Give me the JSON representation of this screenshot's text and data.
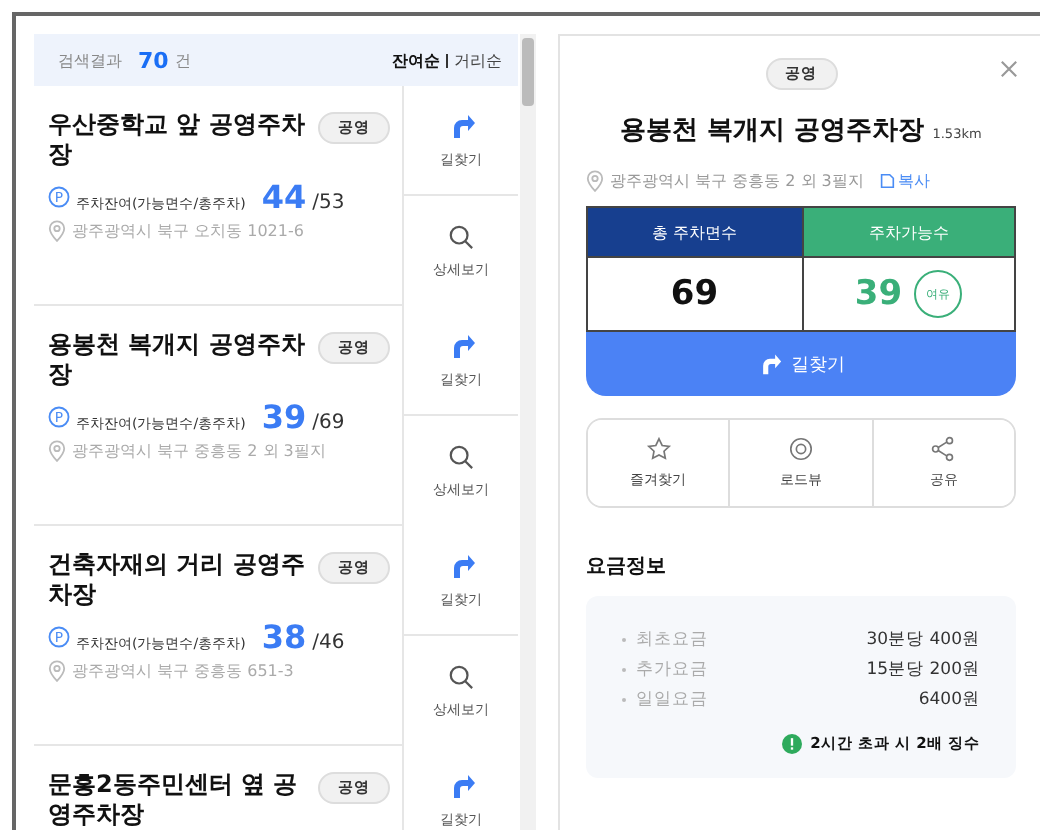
{
  "results_header": {
    "label": "검색결과",
    "count": "70",
    "unit": "건",
    "sort_options": [
      {
        "label": "잔여순",
        "selected": true
      },
      {
        "label": "거리순",
        "selected": false
      }
    ]
  },
  "parking_list": [
    {
      "name": "우산중학교 앞 공영주차장",
      "badge": "공영",
      "parking_icon": "P",
      "availability_label": "주차잔여(가능면수/총주차)",
      "available": "44",
      "total": "/53",
      "address": "광주광역시 북구 오치동 1021-6",
      "actions": [
        "길찾기",
        "상세보기"
      ]
    },
    {
      "name": "용봉천 복개지 공영주차장",
      "badge": "공영",
      "parking_icon": "P",
      "availability_label": "주차잔여(가능면수/총주차)",
      "available": "39",
      "total": "/69",
      "address": "광주광역시 북구 중흥동 2 외 3필지",
      "actions": [
        "길찾기",
        "상세보기"
      ]
    },
    {
      "name": "건축자재의 거리 공영주차장",
      "badge": "공영",
      "parking_icon": "P",
      "availability_label": "주차잔여(가능면수/총주차)",
      "available": "38",
      "total": "/46",
      "address": "광주광역시 북구 중흥동 651-3",
      "actions": [
        "길찾기",
        "상세보기"
      ]
    },
    {
      "name": "문흥2동주민센터 옆 공영주차장",
      "badge": "공영",
      "actions": [
        "길찾기"
      ]
    }
  ],
  "detail": {
    "badge": "공영",
    "title": "용봉천 복개지 공영주차장",
    "distance": "1.53km",
    "address": "광주광역시 북구 중흥동 2 외 3필지",
    "copy_label": "복사",
    "stats": {
      "total_label": "총 주차면수",
      "available_label": "주차가능수",
      "total": "69",
      "available": "39",
      "status": "여유"
    },
    "directions_label": "길찾기",
    "actions": [
      {
        "kind": "star",
        "label": "즐겨찾기"
      },
      {
        "kind": "roadview",
        "label": "로드뷰"
      },
      {
        "kind": "share",
        "label": "공유"
      }
    ],
    "fee_title": "요금정보",
    "fees": [
      {
        "label": "최초요금",
        "value": "30분당 400원"
      },
      {
        "label": "추가요금",
        "value": "15분당 200원"
      },
      {
        "label": "일일요금",
        "value": "6400원"
      }
    ],
    "fee_notice": "2시간 초과 시 2배 징수"
  }
}
